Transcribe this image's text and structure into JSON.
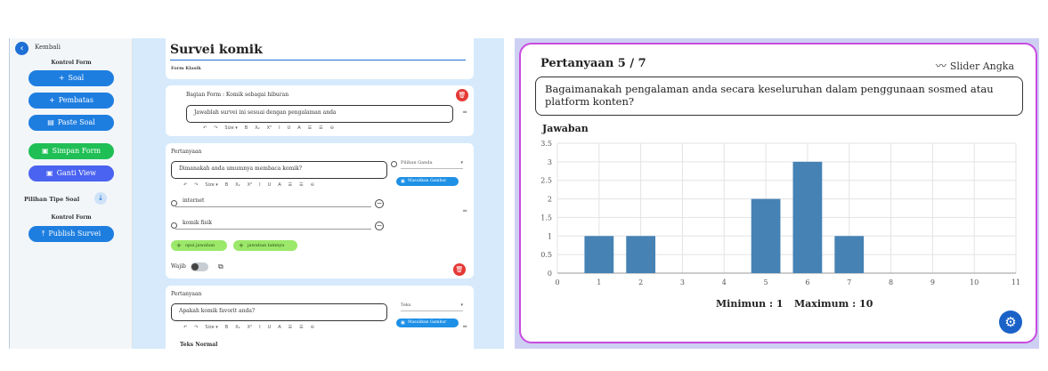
{
  "sidebar": {
    "back_label": "Kembali",
    "kontrol_soal_heading": "Kontrol Form",
    "soal_label": "Soal",
    "pembatas_label": "Pembatas",
    "paste_label": "Paste Soal",
    "simpan_label": "Simpan Form",
    "ganti_label": "Ganti View",
    "tipe_label": "Pilihan Tipe Soal",
    "kontrol_form_heading": "Kontrol Form",
    "publish_label": "Publish Survei"
  },
  "form": {
    "title": "Survei komik",
    "subtitle": "Form Klasik",
    "section": {
      "title": "Bagian Form : Komik sebagai hiburan",
      "description": "Jawablah survei ini sesuai dengan pengalaman anda"
    },
    "toolbar": [
      "↶",
      "↷",
      "Size ▾",
      "B",
      "X₂",
      "X²",
      "I",
      "U",
      "A̶",
      "☰",
      "☰",
      "⊖"
    ],
    "question1": {
      "label": "Pertanyaan",
      "text": "Dimanakah anda umumnya membaca komik?",
      "type": "Pilihan Ganda",
      "image_button": "Masukkan Gambar",
      "options": [
        "internet",
        "komik fisik"
      ],
      "add_option": "opsi jawaban",
      "add_other": "jawaban lainnya",
      "required_label": "Wajib"
    },
    "question2": {
      "label": "Pertanyaan",
      "text": "Apakah komik favorit anda?",
      "type": "Teks",
      "image_button": "Masukkan Gambar",
      "answer_type": "Teks Normal"
    }
  },
  "preview": {
    "question_number": "Pertanyaan 5 / 7",
    "question_type": "Slider Angka",
    "question_text": "Bagaimanakah pengalaman anda secara keseluruhan dalam penggunaan sosmed atau platform konten?",
    "answer_label": "Jawaban",
    "min_text": "Minimun : 1",
    "max_text": "Maximum : 10"
  },
  "chart_data": {
    "type": "bar",
    "x": [
      1,
      2,
      5,
      6,
      7
    ],
    "values": [
      1,
      1,
      2,
      3,
      1
    ],
    "xlim": [
      0,
      11
    ],
    "ylim": [
      0,
      3.5
    ],
    "xticks": [
      "0",
      "1",
      "2",
      "3",
      "4",
      "5",
      "6",
      "7",
      "8",
      "9",
      "10",
      "11"
    ],
    "yticks": [
      "0",
      "0.5",
      "1",
      "1.5",
      "2",
      "2.5",
      "3",
      "3.5"
    ],
    "grid": true,
    "bar_color": "#4682b4"
  },
  "colors": {
    "primary": "#1e7ee0",
    "success": "#1fbf55",
    "violet": "#4a63f0",
    "danger": "#e53935",
    "preview_border": "#c94be0"
  }
}
